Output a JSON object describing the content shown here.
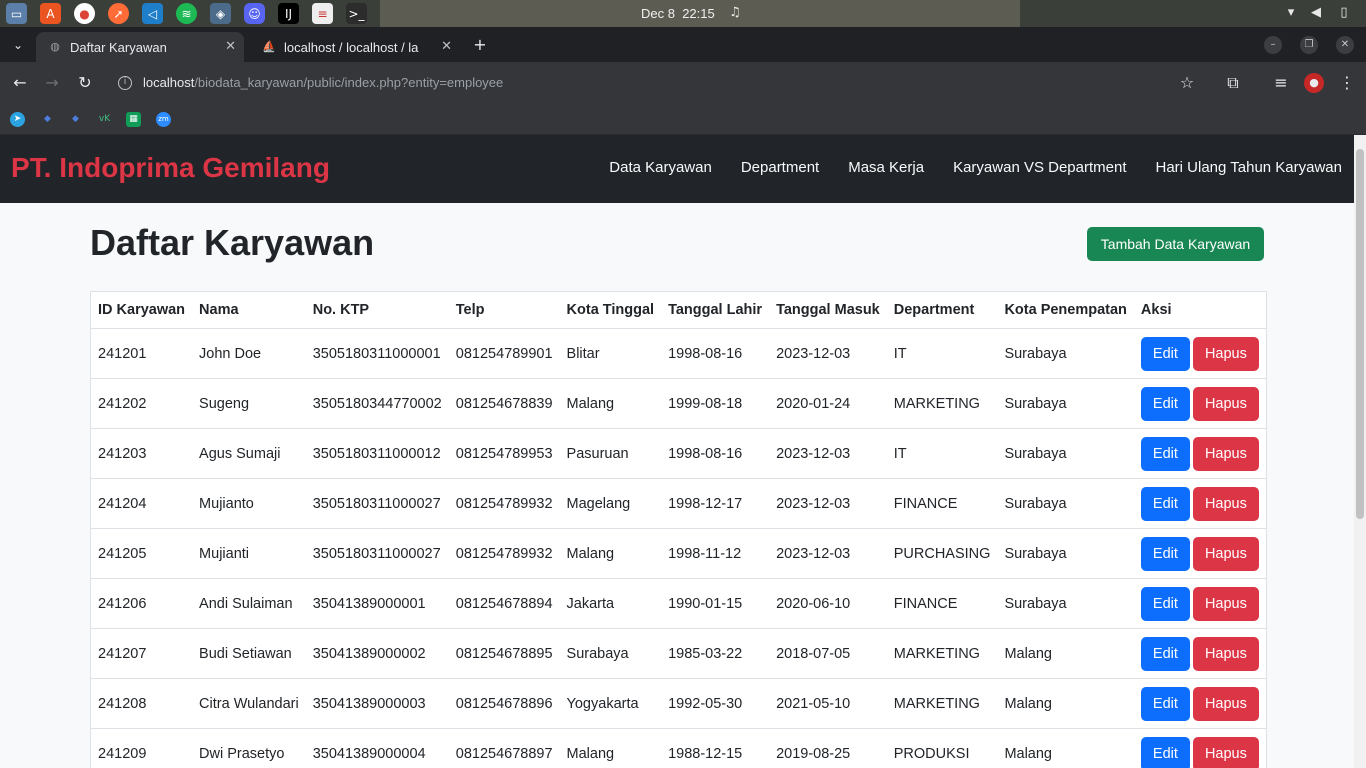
{
  "os": {
    "clock_date": "Dec 8",
    "clock_time": "22:15",
    "dock": [
      "files-icon",
      "app-store-icon",
      "chrome-icon",
      "postman-icon",
      "vscode-icon",
      "spotify-icon",
      "database-icon",
      "discord-icon",
      "intellij-icon",
      "document-viewer-icon",
      "terminal-icon"
    ]
  },
  "browser": {
    "tabs": [
      {
        "label": "Daftar Karyawan",
        "icon": "globe-icon",
        "active": true
      },
      {
        "label": "localhost / localhost / la",
        "icon": "phpmyadmin-icon",
        "active": false
      }
    ],
    "url_host": "localhost",
    "url_path": "/biodata_karyawan/public/index.php?entity=employee",
    "bookmarks": [
      "telegram-icon",
      "diamond-icon",
      "diamond-icon",
      "vk-icon",
      "sheets-icon",
      "zoom-icon"
    ]
  },
  "navbar": {
    "brand": "PT. Indoprima Gemilang",
    "links": [
      "Data Karyawan",
      "Department",
      "Masa Kerja",
      "Karyawan VS Department",
      "Hari Ulang Tahun Karyawan"
    ]
  },
  "main": {
    "title": "Daftar Karyawan",
    "add_button": "Tambah Data Karyawan",
    "table": {
      "headers": [
        "ID Karyawan",
        "Nama",
        "No. KTP",
        "Telp",
        "Kota Tinggal",
        "Tanggal Lahir",
        "Tanggal Masuk",
        "Department",
        "Kota Penempatan",
        "Aksi"
      ],
      "edit_label": "Edit",
      "delete_label": "Hapus",
      "rows": [
        [
          "241201",
          "John Doe",
          "3505180311000001",
          "081254789901",
          "Blitar",
          "1998-08-16",
          "2023-12-03",
          "IT",
          "Surabaya"
        ],
        [
          "241202",
          "Sugeng",
          "3505180344770002",
          "081254678839",
          "Malang",
          "1999-08-18",
          "2020-01-24",
          "MARKETING",
          "Surabaya"
        ],
        [
          "241203",
          "Agus Sumaji",
          "3505180311000012",
          "081254789953",
          "Pasuruan",
          "1998-08-16",
          "2023-12-03",
          "IT",
          "Surabaya"
        ],
        [
          "241204",
          "Mujianto",
          "3505180311000027",
          "081254789932",
          "Magelang",
          "1998-12-17",
          "2023-12-03",
          "FINANCE",
          "Surabaya"
        ],
        [
          "241205",
          "Mujianti",
          "3505180311000027",
          "081254789932",
          "Malang",
          "1998-11-12",
          "2023-12-03",
          "PURCHASING",
          "Surabaya"
        ],
        [
          "241206",
          "Andi Sulaiman",
          "35041389000001",
          "081254678894",
          "Jakarta",
          "1990-01-15",
          "2020-06-10",
          "FINANCE",
          "Surabaya"
        ],
        [
          "241207",
          "Budi Setiawan",
          "35041389000002",
          "081254678895",
          "Surabaya",
          "1985-03-22",
          "2018-07-05",
          "MARKETING",
          "Malang"
        ],
        [
          "241208",
          "Citra Wulandari",
          "35041389000003",
          "081254678896",
          "Yogyakarta",
          "1992-05-30",
          "2021-05-10",
          "MARKETING",
          "Malang"
        ],
        [
          "241209",
          "Dwi Prasetyo",
          "35041389000004",
          "081254678897",
          "Malang",
          "1988-12-15",
          "2019-08-25",
          "PRODUKSI",
          "Malang"
        ]
      ]
    }
  }
}
